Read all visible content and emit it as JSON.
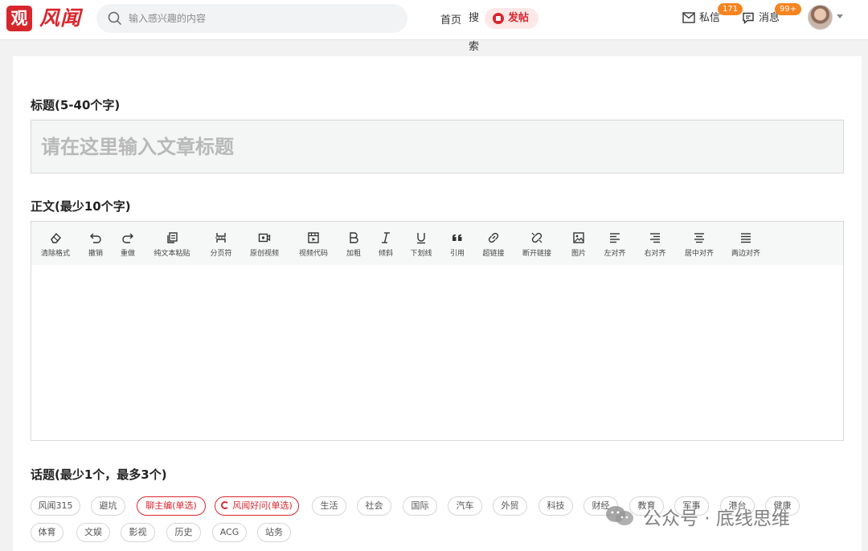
{
  "header": {
    "logo_char": "观",
    "logo_text": "风闻",
    "search_placeholder": "输入感兴趣的内容",
    "search_button": "搜索",
    "nav_home": "首页",
    "post_button": "发帖",
    "messages_label": "私信",
    "messages_badge": "171",
    "notices_label": "消息",
    "notices_badge": "99+"
  },
  "form": {
    "title_label": "标题(5-40个字)",
    "title_placeholder": "请在这里输入文章标题",
    "body_label": "正文(最少10个字)",
    "topics_label": "话题(最少1个，最多3个)"
  },
  "toolbar": [
    {
      "label": "清除格式",
      "icon": "eraser-icon"
    },
    {
      "label": "撤销",
      "icon": "undo-icon"
    },
    {
      "label": "重做",
      "icon": "redo-icon"
    },
    {
      "label": "纯文本粘贴",
      "icon": "paste-icon"
    },
    {
      "label": "分页符",
      "icon": "page-break-icon"
    },
    {
      "label": "原创视频",
      "icon": "video-icon"
    },
    {
      "label": "视频代码",
      "icon": "video-code-icon"
    },
    {
      "label": "加粗",
      "icon": "bold-icon"
    },
    {
      "label": "倾斜",
      "icon": "italic-icon"
    },
    {
      "label": "下划线",
      "icon": "underline-icon"
    },
    {
      "label": "引用",
      "icon": "quote-icon"
    },
    {
      "label": "超链接",
      "icon": "link-icon"
    },
    {
      "label": "断开链接",
      "icon": "unlink-icon"
    },
    {
      "label": "图片",
      "icon": "image-icon"
    },
    {
      "label": "左对齐",
      "icon": "align-left-icon"
    },
    {
      "label": "右对齐",
      "icon": "align-right-icon"
    },
    {
      "label": "居中对齐",
      "icon": "align-center-icon"
    },
    {
      "label": "两边对齐",
      "icon": "align-justify-icon"
    }
  ],
  "topics_row1": [
    {
      "label": "风闻315",
      "active": false
    },
    {
      "label": "避坑",
      "active": false
    },
    {
      "label": "聊主编(单选)",
      "active": true
    },
    {
      "label": "风闻好问(单选)",
      "active": true
    },
    {
      "label": "生活",
      "active": false
    },
    {
      "label": "社会",
      "active": false
    },
    {
      "label": "国际",
      "active": false
    },
    {
      "label": "汽车",
      "active": false
    },
    {
      "label": "外贸",
      "active": false
    },
    {
      "label": "科技",
      "active": false
    },
    {
      "label": "财经",
      "active": false
    },
    {
      "label": "教育",
      "active": false
    },
    {
      "label": "军事",
      "active": false
    },
    {
      "label": "港台",
      "active": false
    },
    {
      "label": "健康",
      "active": false
    }
  ],
  "topics_row2": [
    {
      "label": "体育",
      "active": false
    },
    {
      "label": "文娱",
      "active": false
    },
    {
      "label": "影视",
      "active": false
    },
    {
      "label": "历史",
      "active": false
    },
    {
      "label": "ACG",
      "active": false
    },
    {
      "label": "站务",
      "active": false
    }
  ],
  "watermark": "公众号 · 底线思维",
  "colors": {
    "brand": "#d8262d",
    "badge": "#f5841f"
  }
}
